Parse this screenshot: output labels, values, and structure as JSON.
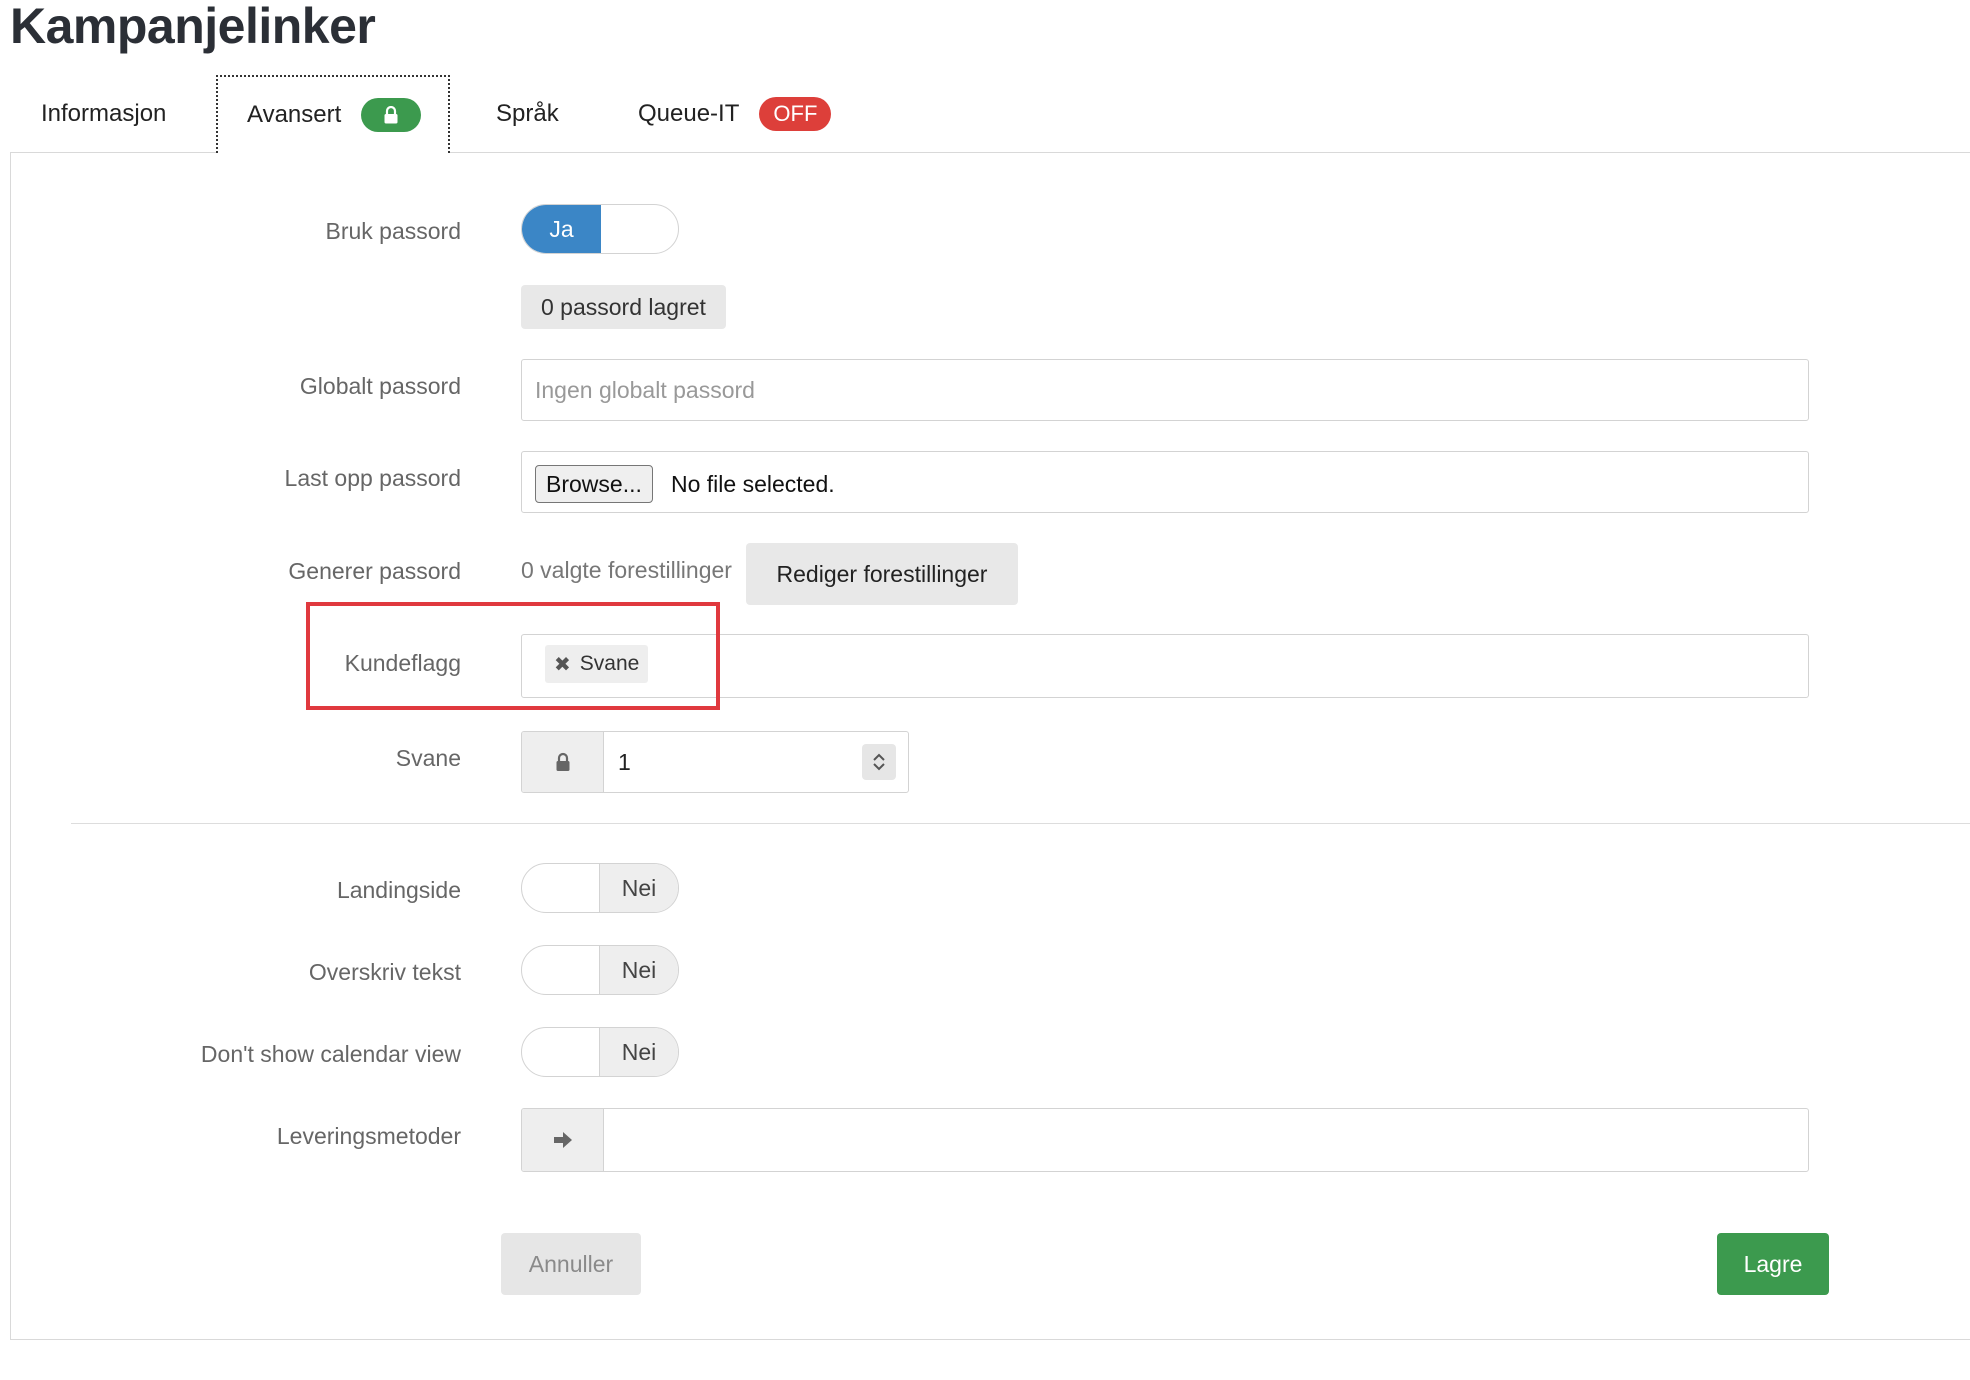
{
  "page": {
    "title": "Kampanjelinker"
  },
  "tabs": [
    {
      "label": "Informasjon"
    },
    {
      "label": "Avansert",
      "badge_icon": "lock-icon"
    },
    {
      "label": "Språk"
    },
    {
      "label": "Queue-IT",
      "badge": "OFF"
    }
  ],
  "form": {
    "use_password": {
      "label": "Bruk passord",
      "value": "Ja",
      "state": "on"
    },
    "stored_passwords": {
      "text": "0 passord lagret"
    },
    "global_password": {
      "label": "Globalt passord",
      "placeholder": "Ingen globalt passord",
      "value": ""
    },
    "upload_password": {
      "label": "Last opp passord",
      "button": "Browse...",
      "status": "No file selected."
    },
    "generate_password": {
      "label": "Generer passord",
      "count_text": "0 valgte forestillinger",
      "button": "Rediger forestillinger"
    },
    "customer_flags": {
      "label": "Kundeflagg",
      "tags": [
        "Svane"
      ]
    },
    "svane": {
      "label": "Svane",
      "value": "1",
      "addon_icon": "lock-icon"
    },
    "landing_page": {
      "label": "Landingside",
      "value": "Nei",
      "state": "off"
    },
    "override_text": {
      "label": "Overskriv tekst",
      "value": "Nei",
      "state": "off"
    },
    "calendar_view": {
      "label": "Don't show calendar view",
      "value": "Nei",
      "state": "off"
    },
    "delivery_methods": {
      "label": "Leveringsmetoder",
      "addon_icon": "arrow-right-icon",
      "value": ""
    }
  },
  "actions": {
    "cancel": "Annuller",
    "save": "Lagre"
  },
  "colors": {
    "primary_blue": "#3b86c6",
    "success_green": "#3c9a4e",
    "danger_red": "#dd3f3a",
    "highlight_red": "#e0393e"
  }
}
